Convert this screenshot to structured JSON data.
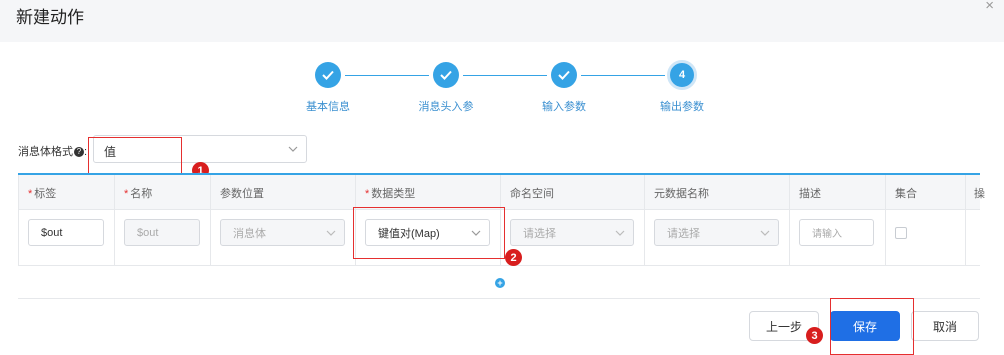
{
  "dialog": {
    "title": "新建动作",
    "close_icon": "×"
  },
  "steps": [
    {
      "label": "基本信息",
      "state": "done"
    },
    {
      "label": "消息头入参",
      "state": "done"
    },
    {
      "label": "输入参数",
      "state": "done"
    },
    {
      "label": "输出参数",
      "state": "active",
      "number": "4"
    }
  ],
  "format": {
    "label": "消息体格式",
    "help_icon": "?",
    "colon": ":",
    "value": "值"
  },
  "table": {
    "columns": [
      "标签",
      "名称",
      "参数位置",
      "数据类型",
      "命名空间",
      "元数据名称",
      "描述",
      "集合",
      "操"
    ],
    "required": [
      true,
      true,
      false,
      true,
      false,
      false,
      false,
      false,
      false
    ],
    "row": {
      "tag": "$out",
      "name": "$out",
      "position": "消息体",
      "data_type": "键值对(Map)",
      "namespace_placeholder": "请选择",
      "metadata_placeholder": "请选择",
      "desc_placeholder": "请输入",
      "collection_checked": false
    }
  },
  "add_icon": "+",
  "badges": [
    "1",
    "2",
    "3"
  ],
  "buttons": {
    "prev": "上一步",
    "save": "保存",
    "cancel": "取消"
  },
  "colors": {
    "accent": "#35a3e5",
    "primary": "#1f6fe5",
    "annotation": "#e52f2f"
  }
}
